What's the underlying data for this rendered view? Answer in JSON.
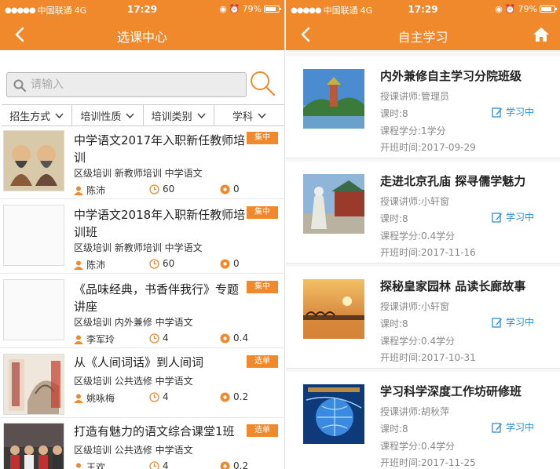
{
  "status_bar": {
    "carrier": "中国联通",
    "network": "4G",
    "time": "17:29",
    "battery": "79%"
  },
  "left": {
    "title": "选课中心",
    "search_placeholder": "请输入",
    "filters": [
      "招生方式",
      "培训性质",
      "培训类别",
      "学科"
    ],
    "courses": [
      {
        "title": "中学语文2017年入职新任教师培训",
        "tag": "集中",
        "tags": "区级培训 新教师培训 中学语文",
        "teacher": "陈沛",
        "hours": "60",
        "credit": "0"
      },
      {
        "title": "中学语文2018年入职新任教师培训班",
        "tag": "集中",
        "tags": "区级培训 新教师培训 中学语文",
        "teacher": "陈沛",
        "hours": "60",
        "credit": "0"
      },
      {
        "title": "《品味经典，书香伴我行》专题讲座",
        "tag": "集中",
        "tags": "区级培训 内外兼修 中学语文",
        "teacher": "李军玲",
        "hours": "4",
        "credit": "0.4"
      },
      {
        "title": "从《人间词话》到人间词",
        "tag": "选单",
        "tags": "区级培训 公共选修 中学语文",
        "teacher": "姚咏梅",
        "hours": "4",
        "credit": "0.2"
      },
      {
        "title": "打造有魅力的语文综合课堂1班",
        "tag": "选单",
        "tags": "区级培训 公共选修 中学语文",
        "teacher": "王欢",
        "hours": "4",
        "credit": "0.2"
      }
    ]
  },
  "right": {
    "title": "自主学习",
    "items": [
      {
        "title": "内外兼修自主学习分院班级",
        "teacher": "授课讲师:管理员",
        "hours": "课时:8",
        "credit": "课程学分:1学分",
        "start": "开班时间:2017-09-29",
        "status": "学习中"
      },
      {
        "title": "走进北京孔庙 探寻儒学魅力",
        "teacher": "授课讲师:小轩窗",
        "hours": "课时:8",
        "credit": "课程学分:0.4学分",
        "start": "开班时间:2017-11-16",
        "status": "学习中"
      },
      {
        "title": "探秘皇家园林 品读长廊故事",
        "teacher": "授课讲师:小轩窗",
        "hours": "课时:8",
        "credit": "课程学分:0.4学分",
        "start": "开班时间:2017-10-31",
        "status": "学习中"
      },
      {
        "title": "学习科学深度工作坊研修班",
        "teacher": "授课讲师:胡秋萍",
        "hours": "课时:8",
        "credit": "课程学分:0.4学分",
        "start": "开班时间:2017-11-25",
        "status": "学习中"
      }
    ]
  },
  "colors": {
    "accent": "#f0882c",
    "link_blue": "#2b8fd8"
  },
  "icons": [
    "back-arrow-icon",
    "home-icon",
    "search-icon",
    "chevron-down-icon",
    "person-icon",
    "clock-icon",
    "credit-icon",
    "edit-icon"
  ]
}
